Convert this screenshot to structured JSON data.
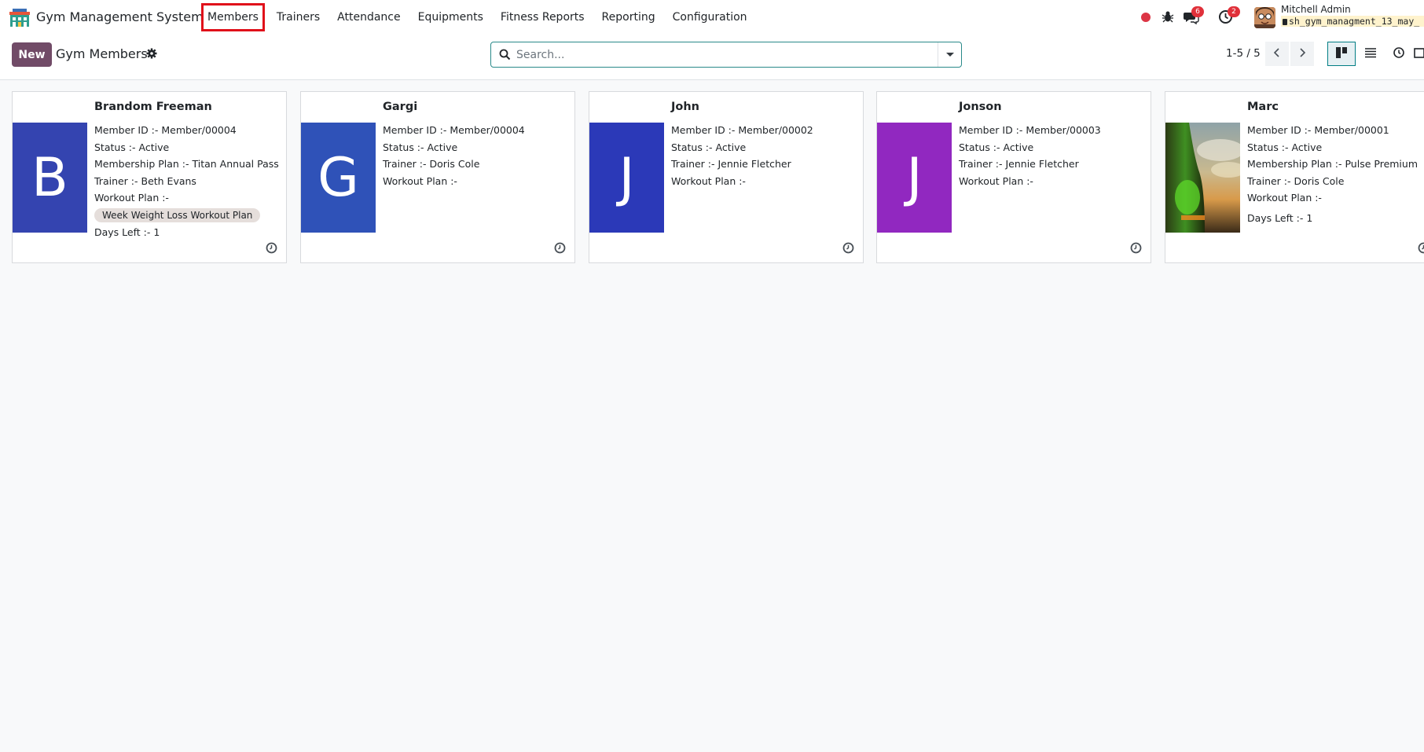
{
  "app": {
    "title": "Gym Management System",
    "icon": "gym-building-icon"
  },
  "menu": [
    {
      "label": "Members",
      "active": true
    },
    {
      "label": "Trainers"
    },
    {
      "label": "Attendance"
    },
    {
      "label": "Equipments"
    },
    {
      "label": "Fitness Reports"
    },
    {
      "label": "Reporting"
    },
    {
      "label": "Configuration"
    }
  ],
  "systray": {
    "messages_count": "6",
    "activities_count": "2",
    "user_name": "Mitchell Admin",
    "db_name": "sh_gym_managment_13_may_"
  },
  "control": {
    "new_label": "New",
    "title": "Gym Members",
    "search_placeholder": "Search...",
    "pager": "1-5 / 5"
  },
  "colors": {
    "brand": "#714b67",
    "accent": "#017e84"
  },
  "members": [
    {
      "name": "Brandom Freeman",
      "initial": "B",
      "color": "#3444b0",
      "lines": [
        "Member ID :- Member/00004",
        "Status :- Active",
        "Membership Plan :- Titan Annual Pass",
        "Trainer :- Beth Evans",
        "Workout Plan :-"
      ],
      "tag": "Week Weight Loss Workout Plan",
      "days_left": "Days Left :- 1"
    },
    {
      "name": "Gargi",
      "initial": "G",
      "color": "#2f52b8",
      "lines": [
        "Member ID :- Member/00004",
        "Status :- Active",
        "Trainer :- Doris Cole",
        "Workout Plan :-"
      ]
    },
    {
      "name": "John",
      "initial": "J",
      "color": "#2b39b8",
      "lines": [
        "Member ID :- Member/00002",
        "Status :- Active",
        "Trainer :- Jennie Fletcher",
        "Workout Plan :-"
      ]
    },
    {
      "name": "Jonson",
      "initial": "J",
      "color": "#9128c0",
      "lines": [
        "Member ID :- Member/00003",
        "Status :- Active",
        "Trainer :- Jennie Fletcher",
        "Workout Plan :-"
      ]
    },
    {
      "name": "Marc",
      "initial": "",
      "color": "#6d6a44",
      "photo": true,
      "lines": [
        "Member ID :- Member/00001",
        "Status :- Active",
        "Membership Plan :- Pulse Premium",
        "Trainer :- Doris Cole",
        "Workout Plan :-"
      ],
      "days_left": "Days Left :- 1"
    }
  ]
}
